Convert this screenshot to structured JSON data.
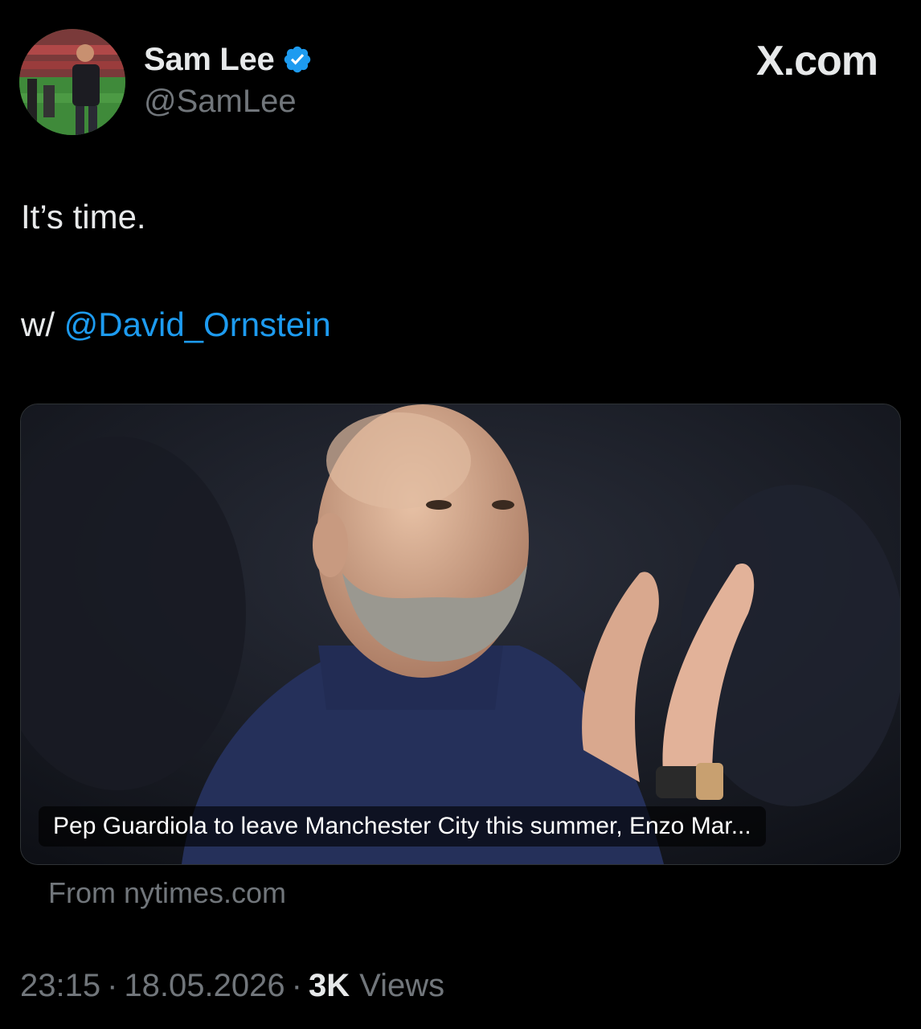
{
  "author": {
    "display_name": "Sam Lee",
    "handle": "@SamLee",
    "verified": true
  },
  "brand": "X.com",
  "tweet": {
    "line1": "It’s time.",
    "line2_prefix": "w/ ",
    "mention": "@David_Ornstein"
  },
  "link_card": {
    "headline": "Pep Guardiola to leave Manchester City this summer, Enzo Mar...",
    "source": "From nytimes.com"
  },
  "meta": {
    "time": "23:15",
    "date": "18.05.2026",
    "separator": "·",
    "views_count": "3K",
    "views_label": "Views"
  },
  "colors": {
    "background": "#000000",
    "primary_text": "#e7e9ea",
    "secondary_text": "#71767b",
    "link": "#1d9bf0",
    "verified_badge": "#1d9bf0"
  }
}
